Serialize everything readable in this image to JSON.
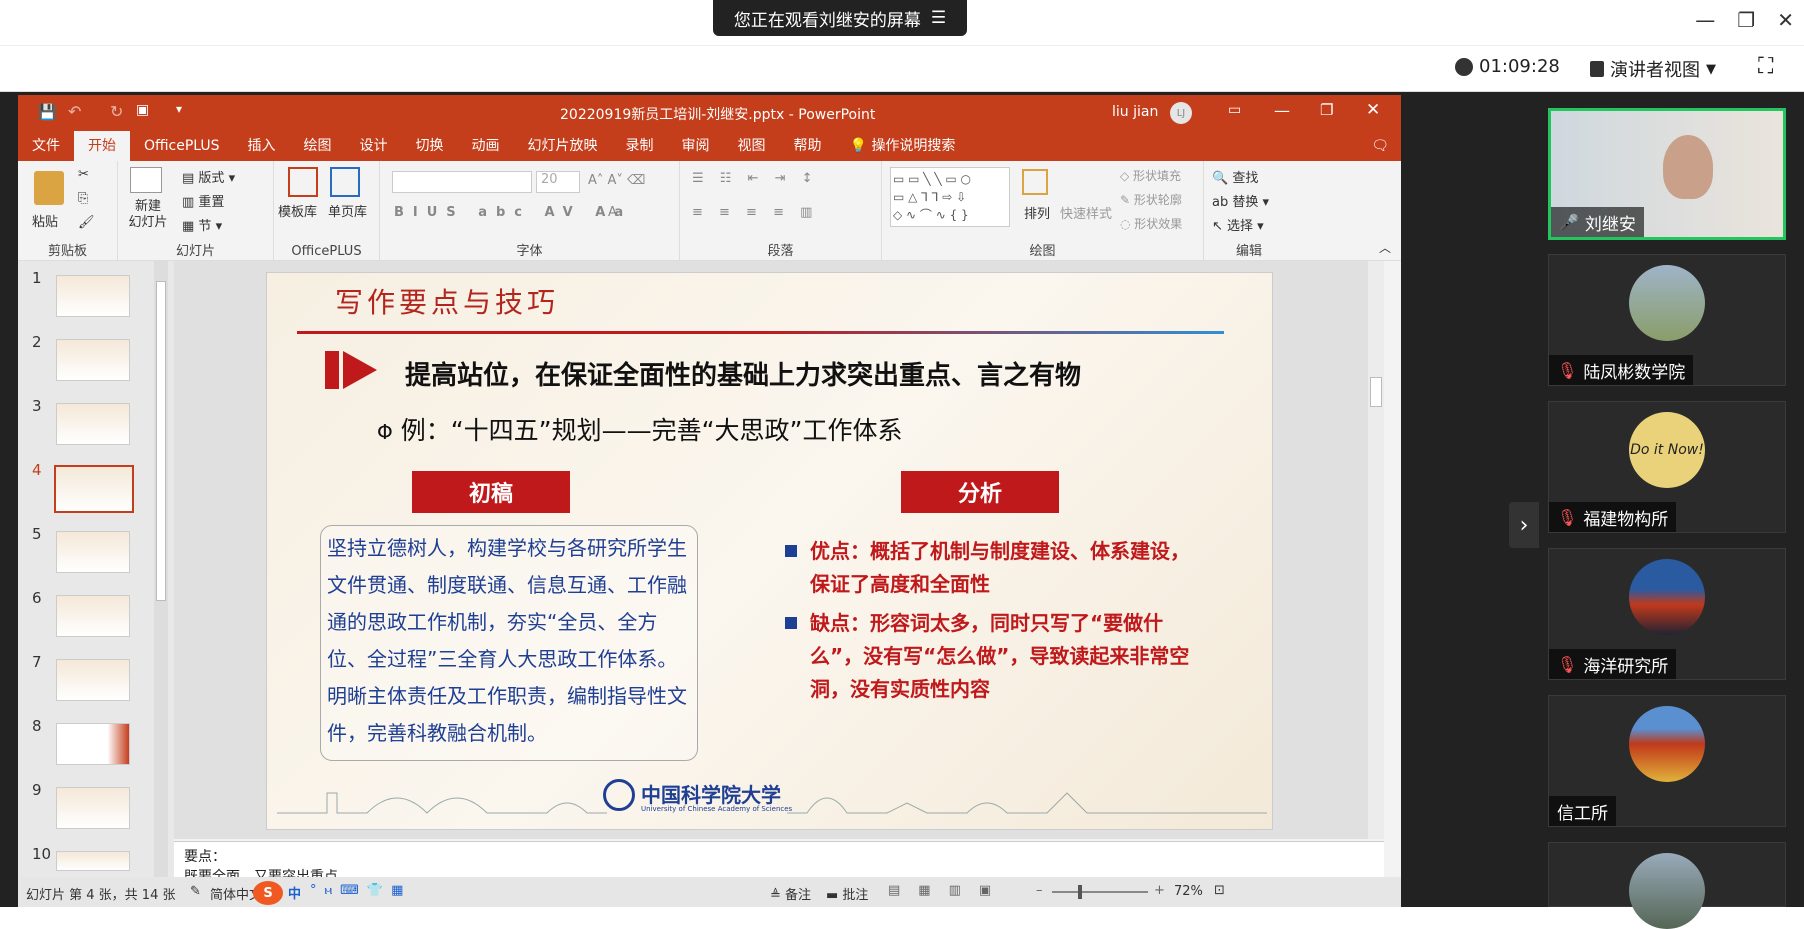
{
  "share_banner": {
    "text": "您正在观看刘继安的屏幕",
    "icon": "menu-icon"
  },
  "window_controls": {
    "minimize": "—",
    "restore": "❐",
    "close": "✕"
  },
  "meeting_bar": {
    "timer": "01:09:28",
    "view_mode": "演讲者视图"
  },
  "ppt": {
    "title": "20220919新员工培训-刘继安.pptx  -  PowerPoint",
    "user": "liu jian",
    "user_initials": "LJ",
    "tabs": [
      "文件",
      "开始",
      "OfficePLUS",
      "插入",
      "绘图",
      "设计",
      "切换",
      "动画",
      "幻灯片放映",
      "录制",
      "审阅",
      "视图",
      "帮助",
      "操作说明搜索"
    ],
    "active_tab": "开始",
    "ribbon_groups": {
      "clipboard": {
        "label": "剪贴板",
        "paste": "粘贴"
      },
      "slides": {
        "label": "幻灯片",
        "new_slide": "新建\n幻灯片",
        "layout": "版式",
        "reset": "重置",
        "section": "节"
      },
      "officeplus": {
        "label": "OfficePLUS",
        "template": "模板库",
        "single": "单页库"
      },
      "font": {
        "label": "字体",
        "size": "20"
      },
      "paragraph": {
        "label": "段落"
      },
      "drawing": {
        "label": "绘图",
        "arrange": "排列",
        "quick_style": "快速样式",
        "fill": "形状填充",
        "outline": "形状轮廓",
        "effect": "形状效果"
      },
      "editing": {
        "label": "编辑",
        "find": "查找",
        "replace": "替换",
        "select": "选择"
      }
    },
    "thumb_numbers": [
      "1",
      "2",
      "3",
      "4",
      "5",
      "6",
      "7",
      "8",
      "9",
      "10"
    ],
    "selected_thumb": 4
  },
  "slide": {
    "header": "写作要点与技巧",
    "headline": "提高站位，在保证全面性的基础上力求突出重点、言之有物",
    "example": "例：“十四五”规划——完善“大思政”工作体系",
    "example_prefix": "Φ",
    "label_draft": "初稿",
    "label_analysis": "分析",
    "draft_text": "坚持立德树人，构建学校与各研究所学生文件贯通、制度联通、信息互通、工作融通的思政工作机制，夯实“全员、全方位、全过程”三全育人大思政工作体系。明晰主体责任及工作职责，编制指导性文件，完善科教融合机制。",
    "pros": "优点：概括了机制与制度建设、体系建设，保证了高度和全面性",
    "cons": "缺点：形容词太多，同时只写了“要做什么”，没有写“怎么做”，导致读起来非常空洞，没有实质性内容",
    "logo_text": "中国科学院大学",
    "logo_sub": "University of Chinese Academy of Sciences"
  },
  "notes": {
    "line1": "要点：",
    "line2": "既要全面，又要突出重点"
  },
  "statusbar": {
    "slide_info": "幻灯片 第 4 张，共 14 张",
    "language": "简体中文",
    "ime": "中",
    "notes_btn": "备注",
    "comments_btn": "批注",
    "zoom": "72%"
  },
  "participants": [
    {
      "name": "刘继安",
      "mic": "on",
      "active": true
    },
    {
      "name": "陆凤彬数学院",
      "mic": "off"
    },
    {
      "name": "福建物构所",
      "mic": "off",
      "avatar_text": "Do it Now!"
    },
    {
      "name": "海洋研究所",
      "mic": "off"
    },
    {
      "name": "信工所",
      "mic": "none"
    },
    {
      "name": "",
      "mic": "none"
    }
  ],
  "colors": {
    "ppt_red": "#c43e1c",
    "accent_red": "#c0191b",
    "active_green": "#22c55e",
    "draft_blue": "#1f3f94"
  }
}
